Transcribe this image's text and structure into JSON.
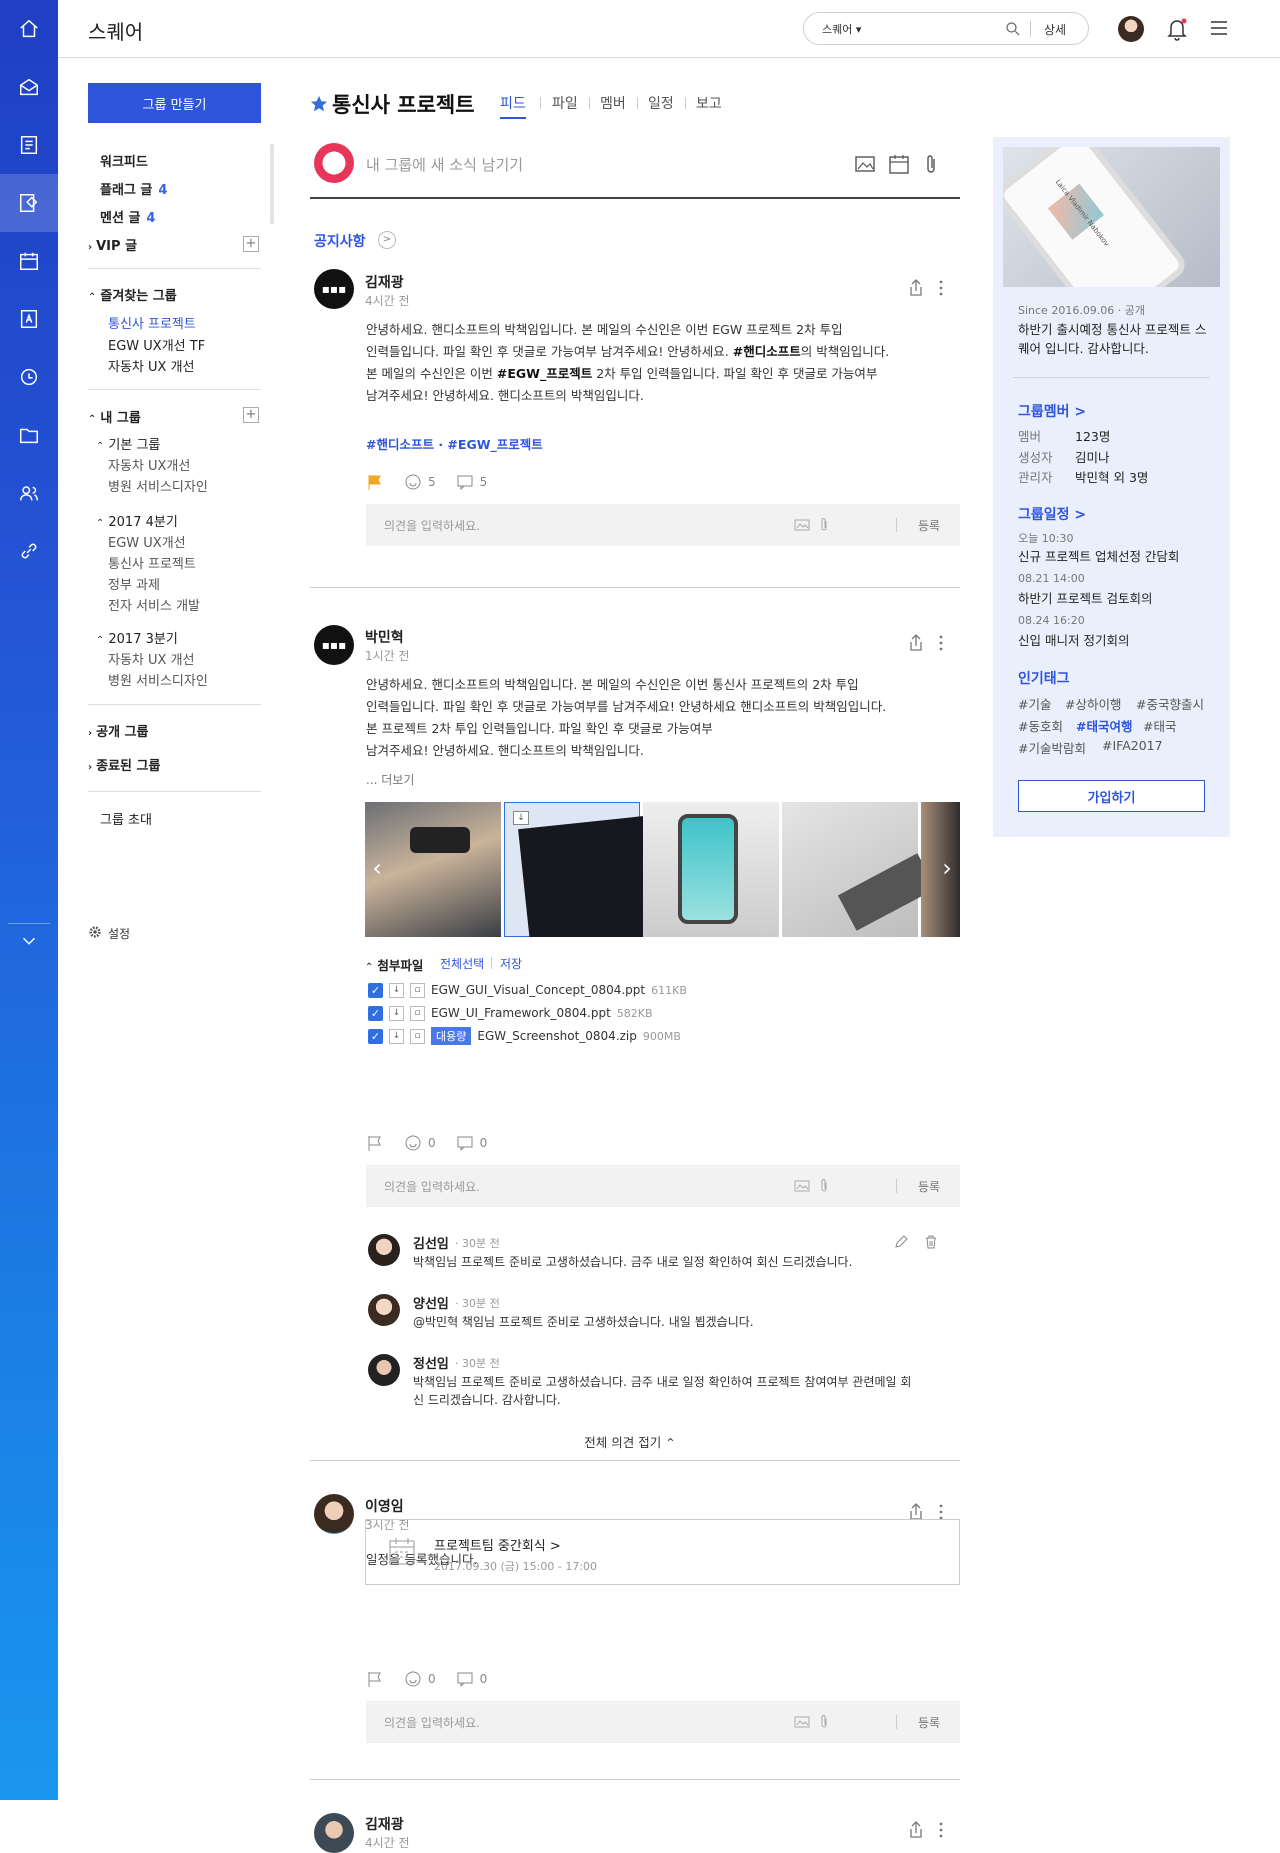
{
  "app": {
    "title": "스퀘어"
  },
  "search": {
    "scope": "스퀘어",
    "detail": "상세"
  },
  "sidebar": {
    "make_group": "그룹 만들기",
    "workfeed": "워크피드",
    "flag_posts": "플래그 글",
    "flag_count": "4",
    "mention_posts": "멘션 글",
    "mention_count": "4",
    "vip_posts": "VIP 글",
    "favorites_title": "즐겨찾는 그룹",
    "favorites": [
      "통신사 프로젝트",
      "EGW UX개선 TF",
      "자동차 UX 개선"
    ],
    "my_groups_title": "내 그룹",
    "sections": [
      {
        "title": "기본 그룹",
        "items": [
          "자동차 UX개선",
          "병원 서비스디자인"
        ]
      },
      {
        "title": "2017 4분기",
        "items": [
          "EGW UX개선",
          "통신사 프로젝트",
          "정부 과제",
          "전자 서비스 개발"
        ]
      },
      {
        "title": "2017 3분기",
        "items": [
          "자동차 UX 개선",
          "병원 서비스디자인"
        ]
      }
    ],
    "public_groups": "공개 그룹",
    "ended_groups": "종료된 그룹",
    "invite": "그룹 초대",
    "settings": "설정"
  },
  "group": {
    "title": "통신사 프로젝트",
    "tabs": [
      "피드",
      "파일",
      "멤버",
      "일정",
      "보고"
    ],
    "active_tab": "피드",
    "compose_placeholder": "내 그룹에 새 소식 남기기",
    "notice_label": "공지사항"
  },
  "posts": [
    {
      "author": "김재광",
      "time": "4시간 전",
      "body_html": "안녕하세요. 핸디소프트의 박책임입니다. 본 메일의 수신인은 이번 EGW 프로젝트 2차 투입<br>인력들입니다. 파일 확인 후 댓글로 가능여부 남겨주세요! 안녕하세요. <b>#핸디소프트</b>의 박책임입니다.<br>본 메일의 수신인은 이번 <b>#EGW_프로젝트</b> 2차 투입 인력들입니다. 파일 확인 후 댓글로 가능여부<br>남겨주세요! 안녕하세요. 핸디소프트의 박책임입니다.",
      "tags": "#핸디소프트 · #EGW_프로젝트",
      "likes": "5",
      "comments": "5"
    },
    {
      "author": "박민혁",
      "time": "1시간 전",
      "body_html": "안녕하세요. 핸디소프트의 박책임입니다. 본 메일의 수신인은 이번 통신사 프로젝트의 2차 투입<br>인력들입니다. 파일 확인 후 댓글로 가능여부를 남겨주세요! 안녕하세요 핸디소프트의 박책임입니다.<br>본 프로젝트 2차 투입 인력들입니다. 파일 확인 후 댓글로 가능여부<br>남겨주세요! 안녕하세요. 핸디소프트의 박책임입니다.",
      "more": "... 더보기",
      "attach_title": "첨부파일",
      "select_all": "전체선택",
      "save": "저장",
      "files": [
        {
          "name": "EGW_GUI_Visual_Concept_0804.ppt",
          "size": "611KB"
        },
        {
          "name": "EGW_UI_Framework_0804.ppt",
          "size": "582KB"
        },
        {
          "name": "EGW_Screenshot_0804.zip",
          "size": "900MB",
          "badge": "대용량"
        }
      ],
      "likes": "0",
      "comments": "0"
    },
    {
      "author": "이영임",
      "time": "3시간 전",
      "body": "일정을 등록했습니다.",
      "schedule_title": "프로젝트팀 중간회식 >",
      "schedule_date": "2017.09.30 (금) 15:00 - 17:00",
      "likes": "0",
      "comments": "0"
    },
    {
      "author": "김재광",
      "time": "4시간 전"
    }
  ],
  "comment_box": {
    "placeholder": "의견을 입력하세요.",
    "submit": "등록"
  },
  "comments": [
    {
      "name": "김선임",
      "time": "· 30분 전",
      "text": "박책임님 프로젝트 준비로 고생하셨습니다. 금주 내로 일정 확인하여 회신 드리겠습니다."
    },
    {
      "name": "양선임",
      "time": "· 30분 전",
      "text": "@박민혁 책임님 프로젝트 준비로 고생하셨습니다. 내일 뵙겠습니다."
    },
    {
      "name": "정선임",
      "time": "· 30분 전",
      "text": "박책임님 프로젝트 준비로 고생하셨습니다. 금주 내로 일정 확인하여 프로젝트 참여여부 관련메일 회신 드리겠습니다. 감사합니다."
    }
  ],
  "fold_all": "전체 의견 접기 ⌃",
  "panel": {
    "since": "Since 2016.09.06 · 공개",
    "description": "하반기 출시예정 통신사 프로젝트 스퀘어 입니다. 감사합니다.",
    "members_title": "그룹멤버 >",
    "member_label": "멤버",
    "member_value": "123명",
    "creator_label": "생성자",
    "creator_value": "김미나",
    "admin_label": "관리자",
    "admin_value": "박민혁 외 3명",
    "schedule_title": "그룹일정 >",
    "schedules": [
      {
        "time": "오늘 10:30",
        "title": "신규 프로젝트 업체선정 간담회"
      },
      {
        "time": "08.21 14:00",
        "title": "하반기 프로젝트 검토회의"
      },
      {
        "time": "08.24 16:20",
        "title": "신입 매니저 정기회의"
      }
    ],
    "tags_title": "인기태그",
    "tags": [
      "#기술",
      "#상하이행",
      "#중국향출시",
      "#동호회",
      "#태국여행",
      "#태국",
      "#기술박람회",
      "#IFA2017"
    ],
    "join": "가입하기",
    "image_text": "Laica Vladimir Nabokov"
  },
  "colors": {
    "accent": "#2f55dc",
    "rail_top": "#1f3fc4",
    "rail_bottom": "#1a97ee"
  }
}
